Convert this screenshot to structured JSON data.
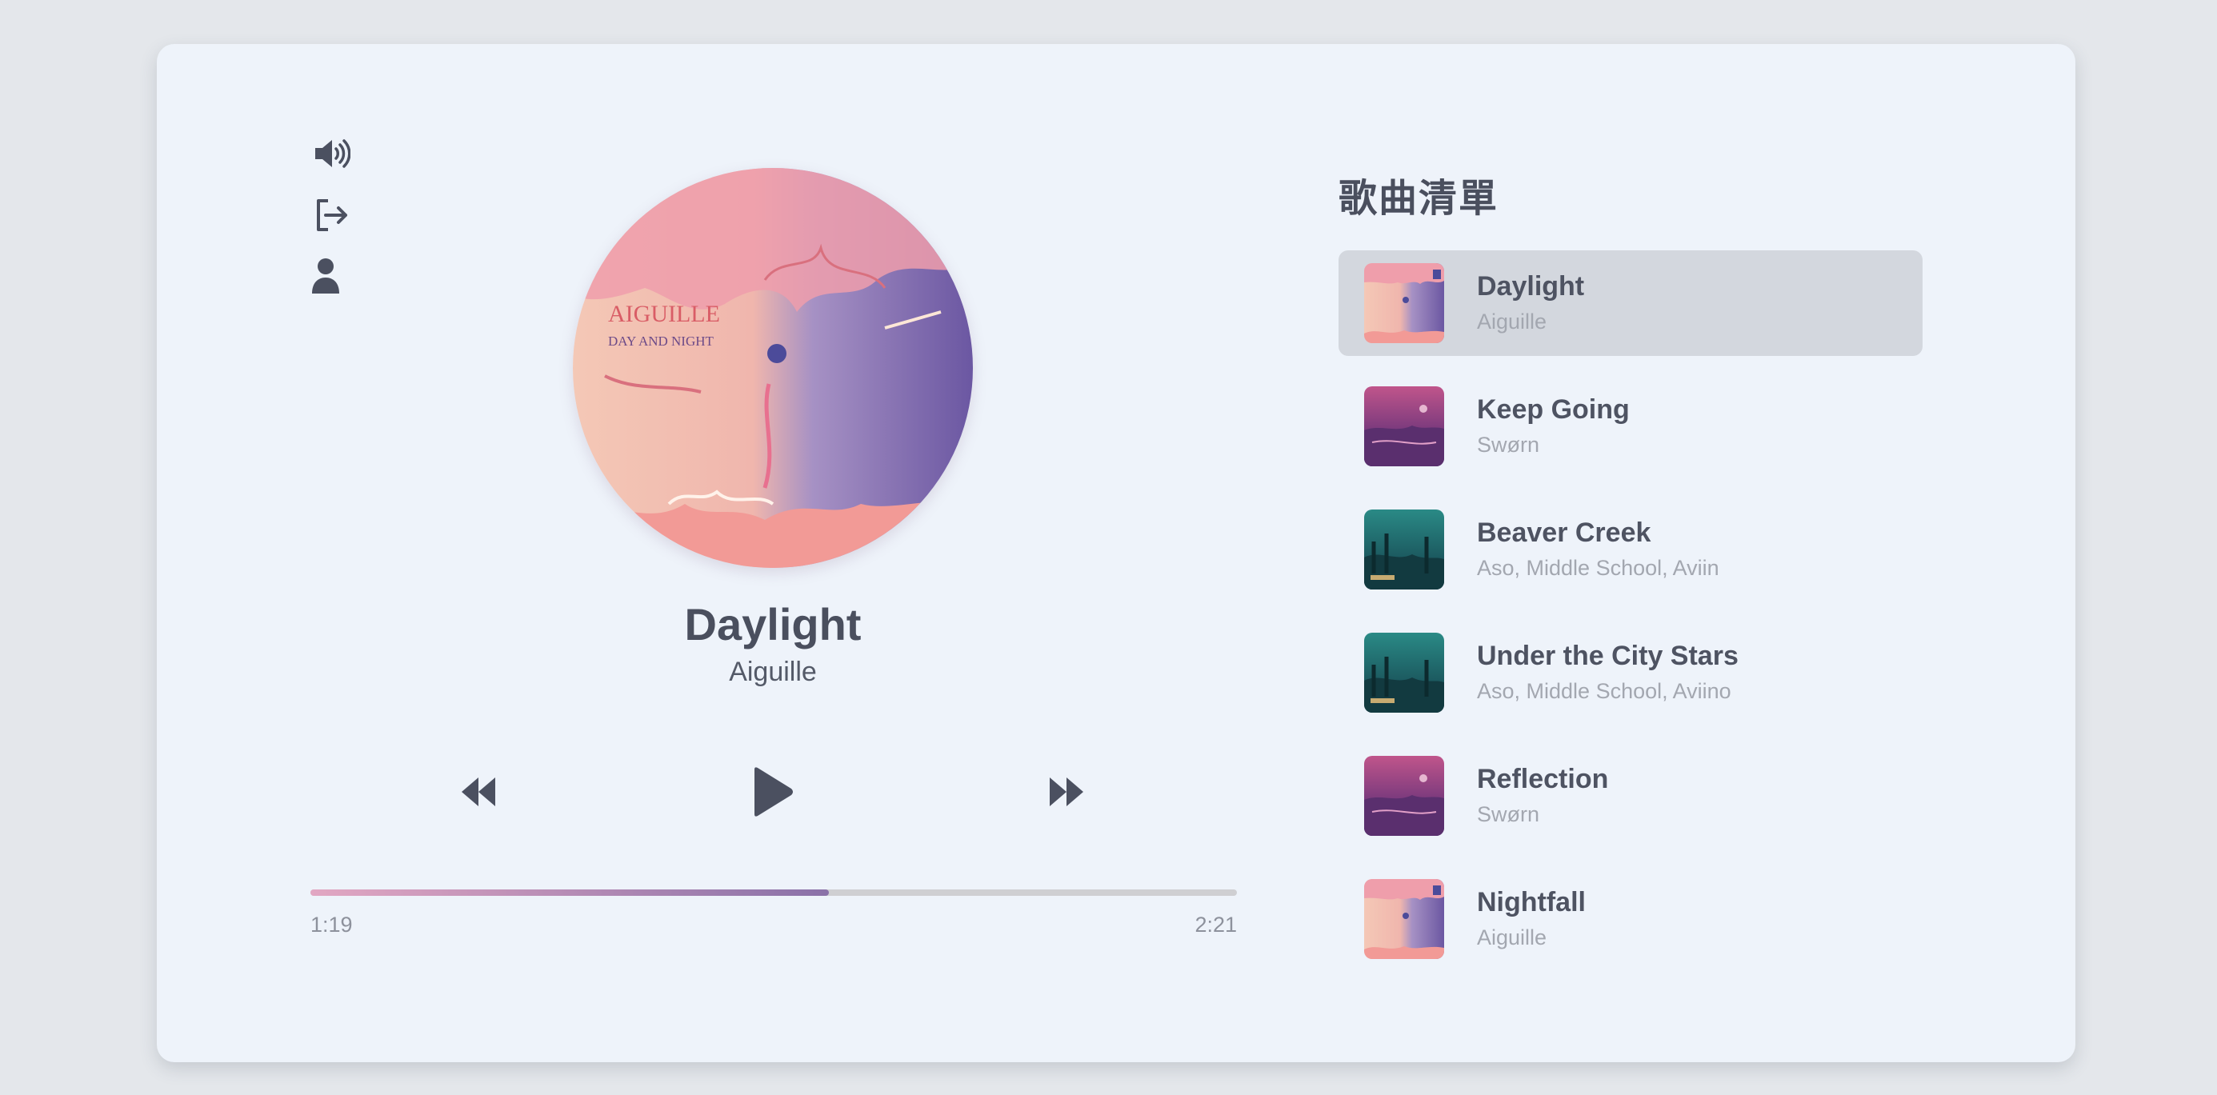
{
  "side_icons": [
    {
      "name": "volume-icon"
    },
    {
      "name": "logout-icon"
    },
    {
      "name": "user-icon"
    }
  ],
  "now_playing": {
    "cover_text_line1": "AIGUILLE",
    "cover_text_line2": "DAY AND NIGHT",
    "title": "Daylight",
    "artist": "Aiguille"
  },
  "controls": {
    "previous_icon": "rewind-icon",
    "play_icon": "play-icon",
    "next_icon": "fast-forward-icon"
  },
  "progress": {
    "current_time": "1:19",
    "duration": "2:21",
    "fraction": 0.56
  },
  "playlist": {
    "heading": "歌曲清單",
    "active_index": 0,
    "items": [
      {
        "title": "Daylight",
        "artist": "Aiguille",
        "art": "daylight"
      },
      {
        "title": "Keep Going",
        "artist": "Swørn",
        "art": "magenta"
      },
      {
        "title": "Beaver Creek",
        "artist": "Aso, Middle School, Aviin",
        "art": "teal"
      },
      {
        "title": "Under the City Stars",
        "artist": "Aso, Middle School, Aviino",
        "art": "teal"
      },
      {
        "title": "Reflection",
        "artist": "Swørn",
        "art": "magenta"
      },
      {
        "title": "Nightfall",
        "artist": "Aiguille",
        "art": "daylight"
      }
    ]
  },
  "colors": {
    "background": "#e4e7eb",
    "card": "#eef3fa",
    "text": "#4a4f5e",
    "muted": "#a3a7b0",
    "active_row": "#d3d7de",
    "progress_start": "#e2a7c2",
    "progress_end": "#8a71a8",
    "track": "#cfcfd2"
  }
}
